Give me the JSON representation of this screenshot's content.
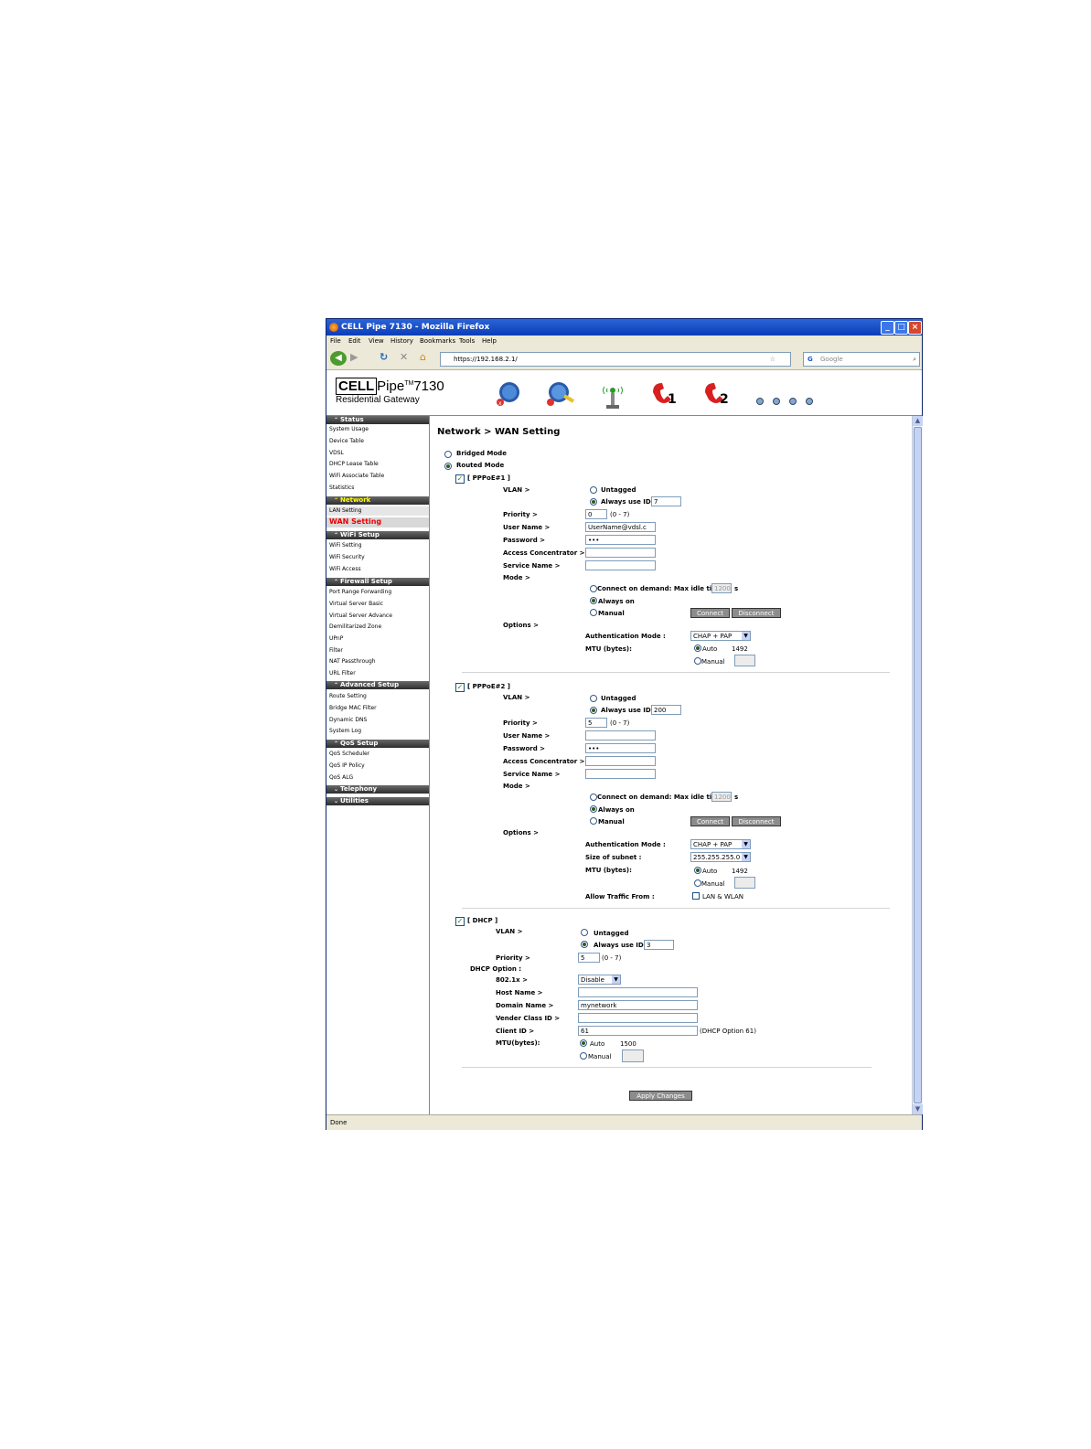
{
  "window": {
    "title": "CELL Pipe 7130 - Mozilla Firefox"
  },
  "menu": [
    "File",
    "Edit",
    "View",
    "History",
    "Bookmarks",
    "Tools",
    "Help"
  ],
  "nav": {
    "url": "https://192.168.2.1/",
    "search_placeholder": "Google"
  },
  "status_bar": "Done",
  "logo": {
    "brand": "CELL",
    "brand_rest": "Pipe",
    "tm": "TM",
    "model": "7130",
    "subtitle": "Residential Gateway"
  },
  "sidebar": [
    {
      "section": "Status",
      "items": [
        "System Usage",
        "Device Table",
        "VDSL",
        "DHCP Lease Table",
        "WiFi Associate Table",
        "Statistics"
      ]
    },
    {
      "section": "Network",
      "items": [
        "LAN Setting",
        "WAN Setting"
      ]
    },
    {
      "section": "WiFi Setup",
      "items": [
        "WiFi Setting",
        "WiFi Security",
        "WiFi Access"
      ]
    },
    {
      "section": "Firewall Setup",
      "items": [
        "Port Range Forwarding",
        "Virtual Server Basic",
        "Virtual Server Advance",
        "Demilitarized Zone",
        "UPnP",
        "Filter",
        "NAT Passthrough",
        "URL Filter"
      ]
    },
    {
      "section": "Advanced Setup",
      "items": [
        "Route Setting",
        "Bridge MAC Filter",
        "Dynamic DNS",
        "System Log"
      ]
    },
    {
      "section": "QoS Setup",
      "items": [
        "QoS Scheduler",
        "QoS IP Policy",
        "QoS ALG"
      ]
    },
    {
      "section": "Telephony",
      "items": []
    },
    {
      "section": "Utilities",
      "items": []
    }
  ],
  "page": {
    "title": "Network > WAN Setting",
    "bridged_mode": "Bridged Mode",
    "routed_mode": "Routed Mode",
    "labels": {
      "vlan": "VLAN >",
      "untagged": "Untagged",
      "always_use_id": "Always use ID :",
      "priority": "Priority >",
      "priority_range": "(0 - 7)",
      "user_name": "User Name >",
      "password": "Password >",
      "access_concentrator": "Access Concentrator >",
      "service_name": "Service Name >",
      "mode": "Mode >",
      "connect_on_demand": "Connect on demand: Max idle time",
      "seconds": "s",
      "always_on": "Always on",
      "manual": "Manual",
      "connect": "Connect",
      "disconnect": "Disconnect",
      "options": "Options >",
      "auth_mode": "Authentication Mode :",
      "mtu": "MTU (bytes):",
      "auto": "Auto",
      "manual_mtu": "Manual",
      "size_of_subnet": "Size of subnet :",
      "allow_traffic": "Allow Traffic From :",
      "lan_wlan": "LAN & WLAN",
      "dhcp_option": "DHCP Option :",
      "dot1x": "802.1x >",
      "host_name": "Host Name >",
      "domain_name": "Domain Name >",
      "vender_class": "Vender Class ID >",
      "client_id": "Client ID >",
      "mtu_dhcp": "MTU(bytes):",
      "dhcp_option_61": "(DHCP Option 61)",
      "dhcp_priority_range": "(0 - 7)"
    },
    "pppoe1": {
      "title": "[ PPPoE#1 ]",
      "vlan_id": "7",
      "priority": "0",
      "user_name": "UserName@vdsl.c",
      "password": "•••",
      "idle_time": "1200",
      "auth_mode": "CHAP + PAP",
      "mtu_auto": "1492"
    },
    "pppoe2": {
      "title": "[ PPPoE#2 ]",
      "vlan_id": "200",
      "priority": "5",
      "password": "•••",
      "idle_time": "1200",
      "auth_mode": "CHAP + PAP",
      "subnet": "255.255.255.0",
      "mtu_auto": "1492"
    },
    "dhcp": {
      "title": "[ DHCP ]",
      "vlan_id": "3",
      "priority": "5",
      "dot1x": "Disable",
      "domain_name": "mynetwork",
      "client_id": "61",
      "mtu_auto": "1500"
    },
    "apply": "Apply Changes"
  }
}
